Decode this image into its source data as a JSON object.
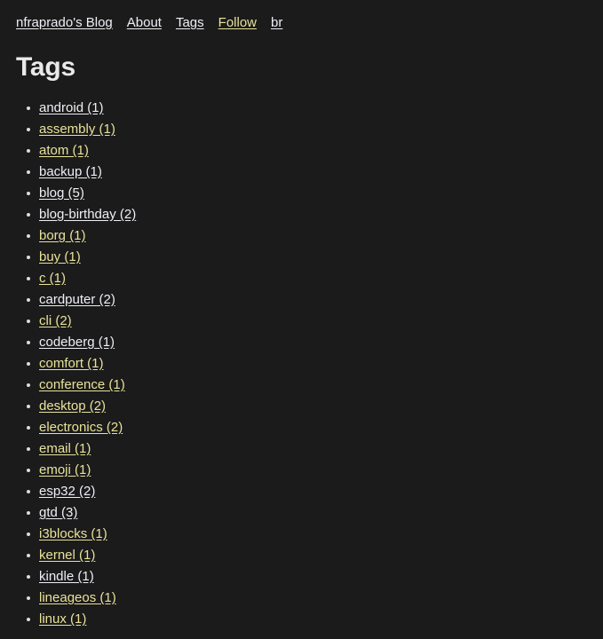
{
  "colors": {
    "background": "#1b1b1b",
    "heading": "#e9e9e9",
    "link_unvisited": "#f0eef5",
    "link_visited": "#e8e29a",
    "bullet": "#dcdce4"
  },
  "nav": {
    "items": [
      {
        "label": "nfraprado's Blog",
        "state": "unvisited"
      },
      {
        "label": "About",
        "state": "unvisited"
      },
      {
        "label": "Tags",
        "state": "unvisited"
      },
      {
        "label": "Follow",
        "state": "visited"
      },
      {
        "label": "br",
        "state": "unvisited"
      }
    ]
  },
  "main": {
    "title": "Tags",
    "tags": [
      {
        "label": "android (1)",
        "name": "android",
        "count": 1,
        "state": "unvisited"
      },
      {
        "label": "assembly (1)",
        "name": "assembly",
        "count": 1,
        "state": "visited"
      },
      {
        "label": "atom (1)",
        "name": "atom",
        "count": 1,
        "state": "visited"
      },
      {
        "label": "backup (1)",
        "name": "backup",
        "count": 1,
        "state": "unvisited"
      },
      {
        "label": "blog (5)",
        "name": "blog",
        "count": 5,
        "state": "unvisited"
      },
      {
        "label": "blog-birthday (2)",
        "name": "blog-birthday",
        "count": 2,
        "state": "unvisited"
      },
      {
        "label": "borg (1)",
        "name": "borg",
        "count": 1,
        "state": "visited"
      },
      {
        "label": "buy (1)",
        "name": "buy",
        "count": 1,
        "state": "visited"
      },
      {
        "label": "c (1)",
        "name": "c",
        "count": 1,
        "state": "visited"
      },
      {
        "label": "cardputer (2)",
        "name": "cardputer",
        "count": 2,
        "state": "unvisited"
      },
      {
        "label": "cli (2)",
        "name": "cli",
        "count": 2,
        "state": "visited"
      },
      {
        "label": "codeberg (1)",
        "name": "codeberg",
        "count": 1,
        "state": "unvisited"
      },
      {
        "label": "comfort (1)",
        "name": "comfort",
        "count": 1,
        "state": "visited"
      },
      {
        "label": "conference (1)",
        "name": "conference",
        "count": 1,
        "state": "visited"
      },
      {
        "label": "desktop (2)",
        "name": "desktop",
        "count": 2,
        "state": "visited"
      },
      {
        "label": "electronics (2)",
        "name": "electronics",
        "count": 2,
        "state": "visited"
      },
      {
        "label": "email (1)",
        "name": "email",
        "count": 1,
        "state": "visited"
      },
      {
        "label": "emoji (1)",
        "name": "emoji",
        "count": 1,
        "state": "visited"
      },
      {
        "label": "esp32 (2)",
        "name": "esp32",
        "count": 2,
        "state": "unvisited"
      },
      {
        "label": "gtd (3)",
        "name": "gtd",
        "count": 3,
        "state": "unvisited"
      },
      {
        "label": "i3blocks (1)",
        "name": "i3blocks",
        "count": 1,
        "state": "visited"
      },
      {
        "label": "kernel (1)",
        "name": "kernel",
        "count": 1,
        "state": "visited"
      },
      {
        "label": "kindle (1)",
        "name": "kindle",
        "count": 1,
        "state": "unvisited"
      },
      {
        "label": "lineageos (1)",
        "name": "lineageos",
        "count": 1,
        "state": "visited"
      },
      {
        "label": "linux (1)",
        "name": "linux",
        "count": 1,
        "state": "visited"
      }
    ]
  }
}
